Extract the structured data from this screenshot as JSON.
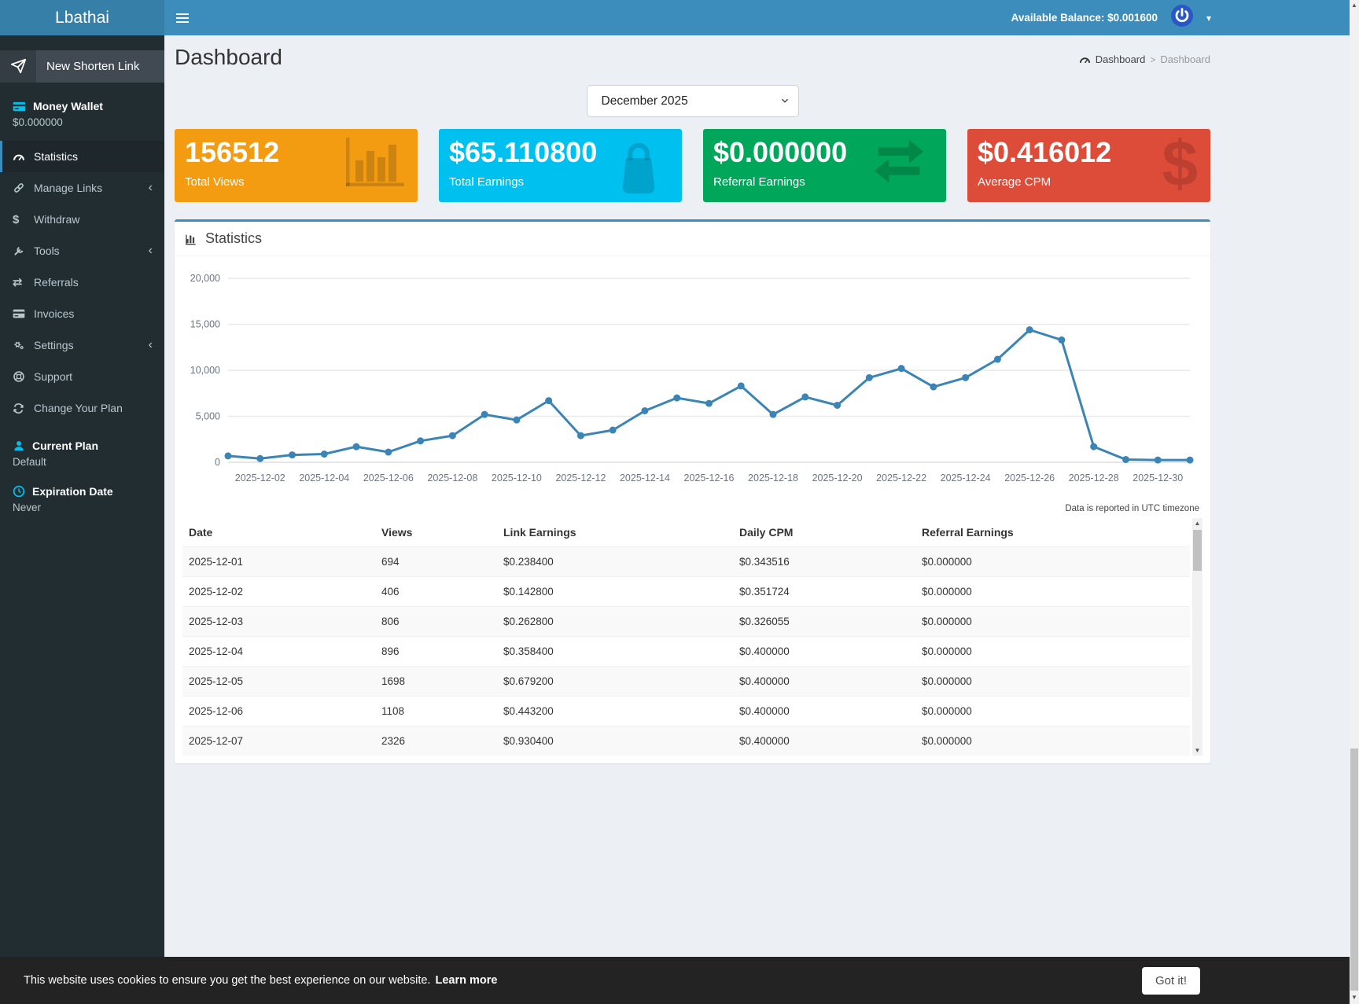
{
  "brand": {
    "name": "Lbathai"
  },
  "topbar": {
    "balance_label": "Available Balance: $0.001600",
    "icons": [
      "hamburger-icon",
      "power-icon",
      "caret-down-icon"
    ]
  },
  "sidebar": {
    "new_link_label": "New Shorten Link",
    "new_link_icon": "paper-plane-icon",
    "wallet": {
      "label": "Money Wallet",
      "value": "$0.000000",
      "icon": "credit-card-icon",
      "icon_color": "#00c0ef"
    },
    "menu": [
      {
        "label": "Statistics",
        "icon": "tachometer-icon",
        "active": true,
        "chevron": false
      },
      {
        "label": "Manage Links",
        "icon": "link-icon",
        "active": false,
        "chevron": true
      },
      {
        "label": "Withdraw",
        "icon": "dollar-icon",
        "active": false,
        "chevron": false
      },
      {
        "label": "Tools",
        "icon": "wrench-icon",
        "active": false,
        "chevron": true
      },
      {
        "label": "Referrals",
        "icon": "exchange-icon",
        "active": false,
        "chevron": false
      },
      {
        "label": "Invoices",
        "icon": "credit-card-icon",
        "active": false,
        "chevron": false
      },
      {
        "label": "Settings",
        "icon": "gears-icon",
        "active": false,
        "chevron": true
      },
      {
        "label": "Support",
        "icon": "life-ring-icon",
        "active": false,
        "chevron": false
      },
      {
        "label": "Change Your Plan",
        "icon": "refresh-icon",
        "active": false,
        "chevron": false
      }
    ],
    "plan": {
      "label": "Current Plan",
      "value": "Default",
      "icon": "user-icon",
      "icon_color": "#00c0ef"
    },
    "expiration": {
      "label": "Expiration Date",
      "value": "Never",
      "icon": "clock-icon",
      "icon_color": "#00c0ef"
    }
  },
  "header": {
    "title": "Dashboard",
    "breadcrumb": [
      "Dashboard",
      "Dashboard"
    ],
    "breadcrumb_separator": ">",
    "breadcrumb_icon": "tachometer-icon"
  },
  "filters": {
    "month": "December 2025"
  },
  "cards": [
    {
      "value": "156512",
      "label": "Total Views",
      "color": "#f39c12",
      "icon": "bar-chart-icon"
    },
    {
      "value": "$65.110800",
      "label": "Total Earnings",
      "color": "#00c0ef",
      "icon": "shopping-bag-icon"
    },
    {
      "value": "$0.000000",
      "label": "Referral Earnings",
      "color": "#00a65a",
      "icon": "exchange-arrows-icon"
    },
    {
      "value": "$0.416012",
      "label": "Average CPM",
      "color": "#dd4b39",
      "icon": "dollar-sign-icon"
    }
  ],
  "stats_box": {
    "title": "Statistics",
    "title_icon": "chart-icon",
    "footnote": "Data is reported in UTC timezone"
  },
  "chart_data": {
    "type": "line",
    "x": [
      "2025-12-01",
      "2025-12-02",
      "2025-12-03",
      "2025-12-04",
      "2025-12-05",
      "2025-12-06",
      "2025-12-07",
      "2025-12-08",
      "2025-12-09",
      "2025-12-10",
      "2025-12-11",
      "2025-12-12",
      "2025-12-13",
      "2025-12-14",
      "2025-12-15",
      "2025-12-16",
      "2025-12-17",
      "2025-12-18",
      "2025-12-19",
      "2025-12-20",
      "2025-12-21",
      "2025-12-22",
      "2025-12-23",
      "2025-12-24",
      "2025-12-25",
      "2025-12-26",
      "2025-12-27",
      "2025-12-28",
      "2025-12-29",
      "2025-12-30",
      "2025-12-31"
    ],
    "values": [
      694,
      406,
      806,
      896,
      1698,
      1108,
      2326,
      2900,
      5200,
      4600,
      6700,
      2900,
      3500,
      5600,
      7000,
      6400,
      8300,
      5200,
      7100,
      6200,
      9200,
      10200,
      8200,
      9200,
      11200,
      14400,
      13300,
      1700,
      300,
      250,
      250
    ],
    "shown_xticks": [
      "2025-12-02",
      "2025-12-04",
      "2025-12-06",
      "2025-12-08",
      "2025-12-10",
      "2025-12-12",
      "2025-12-14",
      "2025-12-16",
      "2025-12-18",
      "2025-12-20",
      "2025-12-22",
      "2025-12-24",
      "2025-12-26",
      "2025-12-28",
      "2025-12-30"
    ],
    "ylim": [
      0,
      20000
    ],
    "yticks": [
      0,
      5000,
      10000,
      15000,
      20000
    ],
    "ytick_labels": [
      "0",
      "5,000",
      "10,000",
      "15,000",
      "20,000"
    ],
    "line_color": "#3a85b5",
    "grid": true,
    "legend": false,
    "title": "Statistics",
    "xlabel": "",
    "ylabel": ""
  },
  "table": {
    "columns": [
      "Date",
      "Views",
      "Link Earnings",
      "Daily CPM",
      "Referral Earnings"
    ],
    "rows": [
      [
        "2025-12-01",
        "694",
        "$0.238400",
        "$0.343516",
        "$0.000000"
      ],
      [
        "2025-12-02",
        "406",
        "$0.142800",
        "$0.351724",
        "$0.000000"
      ],
      [
        "2025-12-03",
        "806",
        "$0.262800",
        "$0.326055",
        "$0.000000"
      ],
      [
        "2025-12-04",
        "896",
        "$0.358400",
        "$0.400000",
        "$0.000000"
      ],
      [
        "2025-12-05",
        "1698",
        "$0.679200",
        "$0.400000",
        "$0.000000"
      ],
      [
        "2025-12-06",
        "1108",
        "$0.443200",
        "$0.400000",
        "$0.000000"
      ],
      [
        "2025-12-07",
        "2326",
        "$0.930400",
        "$0.400000",
        "$0.000000"
      ]
    ]
  },
  "cookie_banner": {
    "message": "This website uses cookies to ensure you get the best experience on our website.",
    "link_label": "Learn more",
    "button_label": "Got it!"
  },
  "colors": {
    "navbar": "#3c8dbc",
    "logo_bg": "#367fa9",
    "sidebar": "#222d32",
    "card_orange": "#f39c12",
    "card_aqua": "#00c0ef",
    "card_green": "#00a65a",
    "card_red": "#dd4b39",
    "accent": "#3c8dbc",
    "cyan_icon": "#00c0ef"
  }
}
